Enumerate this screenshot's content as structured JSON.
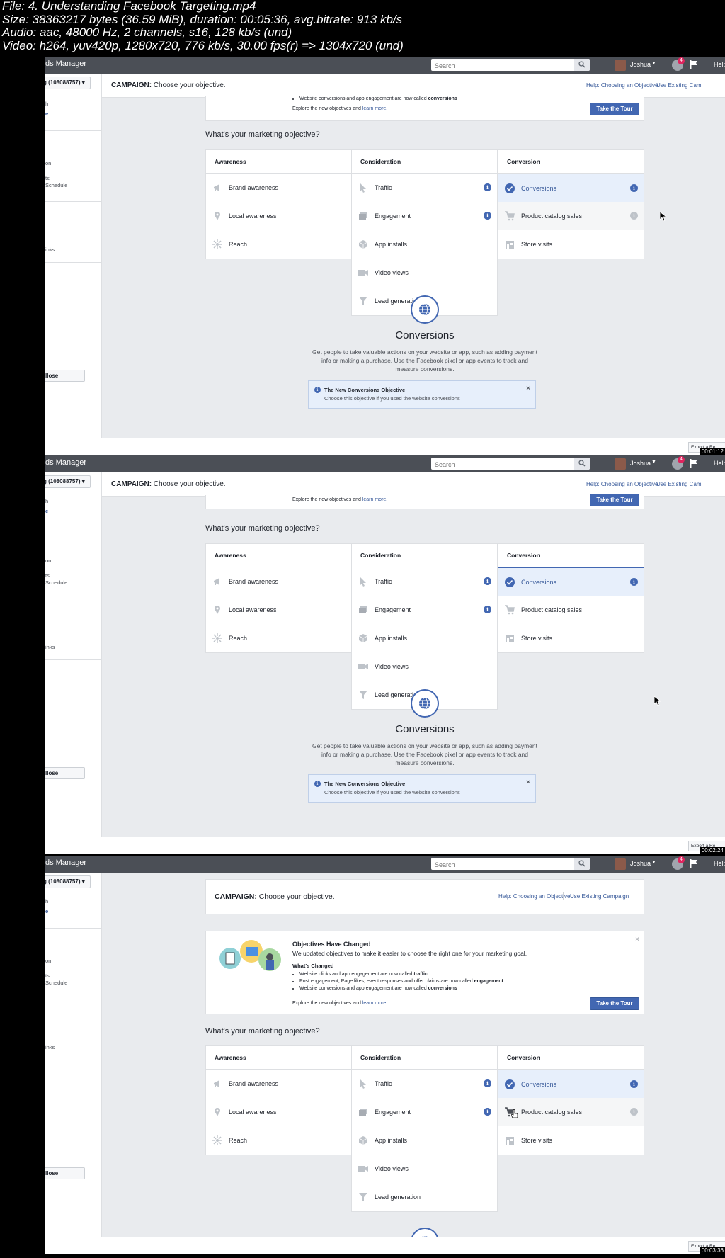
{
  "file_info": {
    "line1": "File: 4. Understanding Facebook Targeting.mp4",
    "line2": "Size: 38363217 bytes (36.59 MiB), duration: 00:05:36, avg.bitrate: 913 kb/s",
    "line3": "Audio: aac, 48000 Hz, 2 channels, s16, 128 kb/s (und)",
    "line4": "Video: h264, yuv420p, 1280x720, 776 kb/s, 30.00 fps(r) => 1304x720 (und)"
  },
  "topbar": {
    "app_title": "ds Manager",
    "search_placeholder": "Search",
    "user_name": "Joshua",
    "notif_count": "4",
    "help": "Help"
  },
  "sidebar": {
    "account": "g (108088757)",
    "item1": "h",
    "item2": "e",
    "item3": "on",
    "item4": "ts",
    "item5": "Schedule",
    "item6": "inks",
    "close": "llose"
  },
  "campaign": {
    "label_bold": "CAMPAIGN:",
    "label_rest": " Choose your objective.",
    "help_link": "Help: Choosing an Objective",
    "use_existing": "Use Existing Campaign",
    "use_existing_cut": "Use Existing Cam"
  },
  "notice": {
    "title": "Objectives Have Changed",
    "subtitle": "We updated objectives to make it easier to choose the right one for your marketing goal.",
    "whats_changed": "What's Changed",
    "b1_pre": "Website clicks and app engagement are now called ",
    "b1_bold": "traffic",
    "b2_pre": "Post engagement, Page likes, event responses and offer claims are now called ",
    "b2_bold": "engagement",
    "b3_pre": "Website conversions and app engagement are now called ",
    "b3_bold": "conversions",
    "explore_pre": "Explore the new objectives and ",
    "explore_link": "learn more.",
    "tour_button": "Take the Tour",
    "close": "×"
  },
  "objective_question": "What's your marketing objective?",
  "columns": {
    "awareness": "Awareness",
    "consideration": "Consideration",
    "conversion": "Conversion"
  },
  "objectives": {
    "brand_awareness": "Brand awareness",
    "local_awareness": "Local awareness",
    "reach": "Reach",
    "traffic": "Traffic",
    "engagement": "Engagement",
    "app_installs": "App installs",
    "video_views": "Video views",
    "lead_generation": "Lead generation",
    "conversions": "Conversions",
    "product_catalog_sales": "Product catalog sales",
    "store_visits": "Store visits"
  },
  "detail": {
    "title": "Conversions",
    "description": "Get people to take valuable actions on your website or app, such as adding payment info or making a purchase. Use the Facebook pixel or app events to track and measure conversions.",
    "box_title": "The New Conversions Objective",
    "box_text": "Choose this objective if you used the website conversions"
  },
  "bottom": {
    "export": "Export a Re",
    "timecode1": "00:01:12",
    "timecode2": "00:02:24",
    "timecode3": "00:03:36"
  },
  "colors": {
    "accent": "#4267b2",
    "link": "#365899",
    "topbar": "#4b4f56",
    "selected_bg": "#e7effb"
  }
}
